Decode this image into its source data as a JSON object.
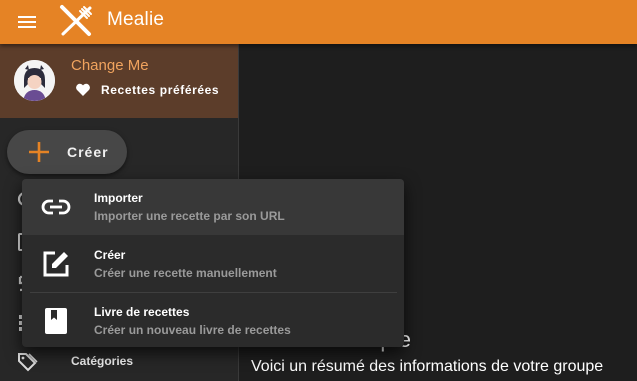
{
  "appbar": {
    "title": "Mealie",
    "menu_icon": "hamburger-menu-icon",
    "logo_icon": "fork-knife-logo-icon",
    "color": "#e58325"
  },
  "sidebar": {
    "user_name": "Change Me",
    "favorites_label": "Recettes préférées",
    "create_label": "Créer",
    "category_label": "Catégories",
    "icons": [
      "search-icon",
      "calendar-icon",
      "format-list-icon",
      "view-grid-icon",
      "tags-icon"
    ]
  },
  "main": {
    "title": "Profil du compte",
    "subtitle": "Voici un résumé des informations de votre groupe"
  },
  "popup": {
    "items": [
      {
        "title": "Importer",
        "description": "Importer une recette par son URL",
        "icon": "link-icon"
      },
      {
        "title": "Créer",
        "description": "Créer une recette manuellement",
        "icon": "edit-icon"
      },
      {
        "title": "Livre de recettes",
        "description": "Créer un nouveau livre de recettes",
        "icon": "book-icon"
      }
    ]
  },
  "colors": {
    "accent": "#e58325",
    "profile_bg": "#5c3d2a",
    "user_name": "#f0a35e"
  }
}
